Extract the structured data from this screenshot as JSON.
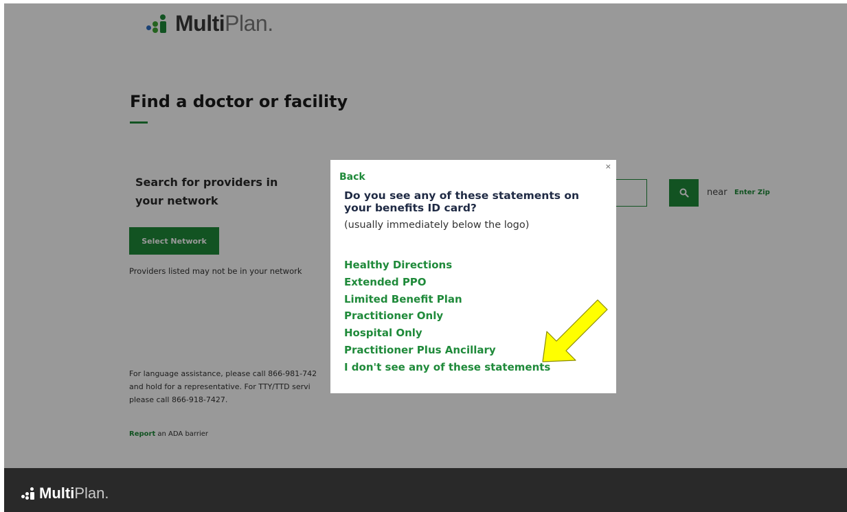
{
  "header": {
    "logo_bold": "Multi",
    "logo_light": "Plan",
    "logo_dot": "."
  },
  "main": {
    "title": "Find a doctor or facility",
    "search_label": "Search for providers in your network",
    "select_network_label": "Select Network",
    "providers_note": "Providers listed may not be in your network",
    "search_icon": "search-icon",
    "near_label": "near",
    "zip_link": "Enter Zip",
    "language_assistance": "For language assistance, please call 866-981-742 and hold for a representative. For TTY/TTD servi please call 866-918-7427.",
    "ada_link": "Report",
    "ada_text": " an ADA barrier"
  },
  "modal": {
    "close_label": "×",
    "back_label": "Back",
    "question": "Do you see any of these statements on your benefits ID card?",
    "hint": "(usually immediately below the logo)",
    "options": [
      "Healthy Directions",
      "Extended PPO",
      "Limited Benefit Plan",
      "Practitioner Only",
      "Hospital Only",
      "Practitioner Plus Ancillary",
      "I don't see any of these statements"
    ]
  },
  "footer": {
    "logo_bold": "Multi",
    "logo_light": "Plan",
    "logo_dot": "."
  },
  "colors": {
    "brand_green": "#1f8a3a",
    "annotation_yellow": "#ffff00",
    "footer_bg": "#292929"
  }
}
